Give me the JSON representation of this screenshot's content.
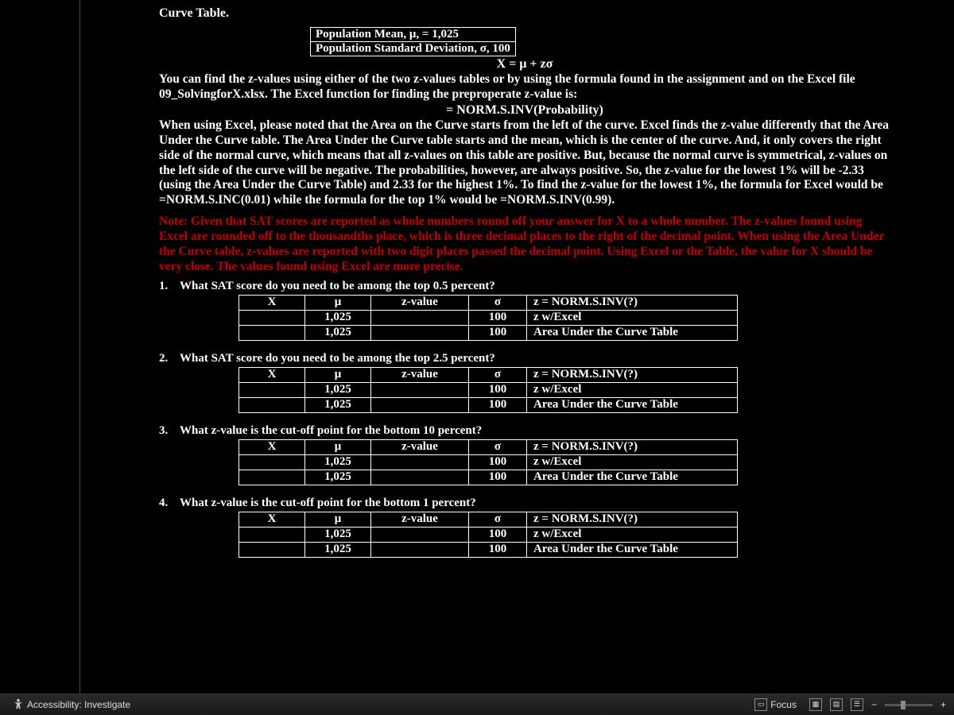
{
  "header": "Curve Table.",
  "params": {
    "line1": "Population Mean, μ, = 1,025",
    "line2": "Population Standard Deviation, σ, 100"
  },
  "formula": "X = μ + zσ",
  "para1": "You can find the z-values using either of the two z-values tables or by using the formula found in the assignment and on the Excel file 09_SolvingforX.xlsx. The Excel function for finding the preproperate z-value is:",
  "excel_fn": "= NORM.S.INV(Probability)",
  "para2": "When using Excel, please noted that the Area on the Curve starts from the left of the curve. Excel finds the z-value differently that the Area Under the Curve table. The Area Under the Curve table starts and the mean, which is the center of the curve. And, it only covers the right side of the normal curve, which means that all z-values on this table are positive. But, because the normal curve is symmetrical, z-values on the left side of the curve will be negative. The probabilities, however, are always positive. So, the z-value for the lowest 1% will be -2.33 (using the Area Under the Curve Table) and 2.33 for the highest 1%. To find the z-value for the lowest 1%, the formula for Excel would be =NORM.S.INC(0.01) while the formula for the top 1% would be =NORM.S.INV(0.99).",
  "note": "Note: Given that SAT scores are reported as whole numbers round off your answer for X to a whole number. The z-values found using Excel are rounded off to the thousandths place, which is three decimal places to the right of the decimal point. When using the Area Under the Curve table, z-values are reported with two digit places passed the decimal point. Using Excel or the Table, the value for X should be very close. The values found using Excel are more precise.",
  "th": {
    "x": "X",
    "mu": "μ",
    "z": "z-value",
    "s": "σ",
    "desc": "z = NORM.S.INV(?)"
  },
  "rows": {
    "r1": {
      "mu": "1,025",
      "s": "100",
      "desc": "z w/Excel"
    },
    "r2": {
      "mu": "1,025",
      "s": "100",
      "desc": "Area Under the Curve Table"
    }
  },
  "q1": {
    "num": "1.",
    "text": "What SAT score do you need to be among the top 0.5 percent?"
  },
  "q2": {
    "num": "2.",
    "text": "What SAT score do you need to be among the top 2.5 percent?"
  },
  "q3": {
    "num": "3.",
    "text": "What z-value is the cut-off point for the bottom 10 percent?"
  },
  "q4": {
    "num": "4.",
    "text": "What z-value is the cut-off point for the bottom 1 percent?"
  },
  "status": {
    "accessibility": "Accessibility: Investigate",
    "focus": "Focus",
    "minus": "−",
    "plus": "+"
  }
}
